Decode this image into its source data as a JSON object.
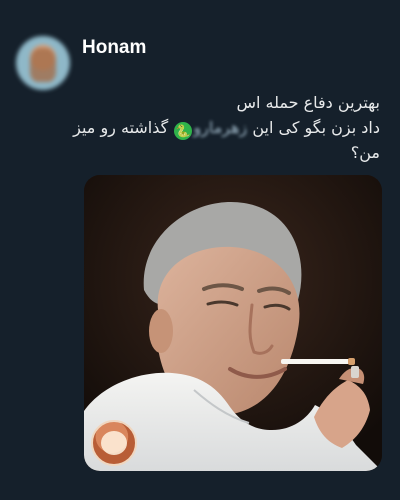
{
  "post": {
    "username": "Honam",
    "text_line_1": "بهترین دفاع حمله اس",
    "text_line_2_before": "داد بزن بگو کی این ",
    "text_line_2_blurred": "زهرمارو",
    "text_line_2_after": " گذاشته رو میز",
    "text_line_3": "من؟",
    "emoji": "🐍"
  },
  "colors": {
    "background": "#15202b",
    "text": "#e7e9ea",
    "username": "#ffffff",
    "emoji": "#2fb34a"
  },
  "icons": {
    "avatar": "profile-avatar",
    "badge": "watermark-logo"
  }
}
